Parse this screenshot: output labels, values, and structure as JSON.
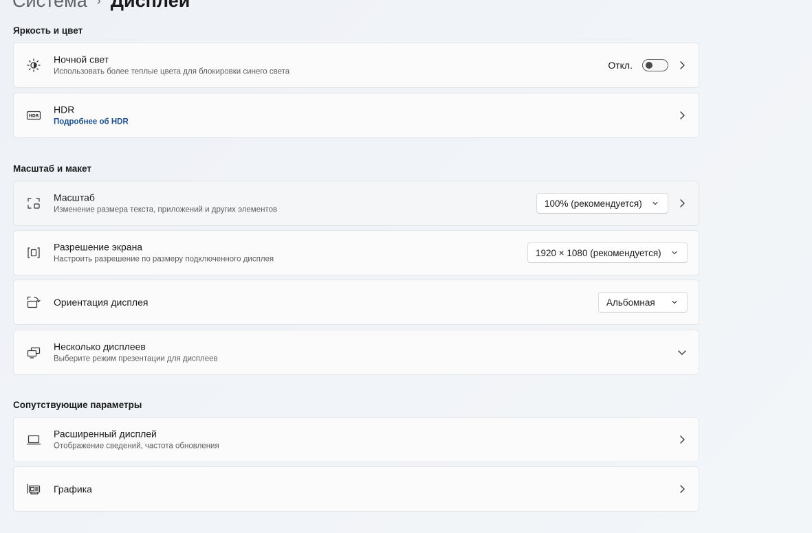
{
  "breadcrumb": {
    "parent": "Система",
    "separator": "›",
    "current": "Дисплей"
  },
  "sections": {
    "brightness": {
      "title": "Яркость и цвет",
      "night_light": {
        "title": "Ночной свет",
        "subtitle": "Использовать более теплые цвета для блокировки синего света",
        "state_label": "Откл.",
        "enabled": false
      },
      "hdr": {
        "title": "HDR",
        "link": "Подробнее об HDR"
      }
    },
    "scale_layout": {
      "title": "Масштаб и макет",
      "scale": {
        "title": "Масштаб",
        "subtitle": "Изменение размера текста, приложений и других элементов",
        "value": "100% (рекомендуется)"
      },
      "resolution": {
        "title": "Разрешение экрана",
        "subtitle": "Настроить разрешение по размеру подключенного дисплея",
        "value": "1920 × 1080 (рекомендуется)"
      },
      "orientation": {
        "title": "Ориентация дисплея",
        "value": "Альбомная"
      },
      "multiple": {
        "title": "Несколько дисплеев",
        "subtitle": "Выберите режим презентации для дисплеев"
      }
    },
    "related": {
      "title": "Сопутствующие параметры",
      "advanced": {
        "title": "Расширенный дисплей",
        "subtitle": "Отображение сведений, частота обновления"
      },
      "graphics": {
        "title": "Графика"
      }
    }
  },
  "icons": {
    "night_light": "brightness-icon",
    "hdr": "hdr-icon",
    "scale": "scale-icon",
    "resolution": "resolution-icon",
    "orientation": "orientation-icon",
    "multiple": "multiple-displays-icon",
    "advanced": "laptop-display-icon",
    "graphics": "graphics-card-icon"
  }
}
